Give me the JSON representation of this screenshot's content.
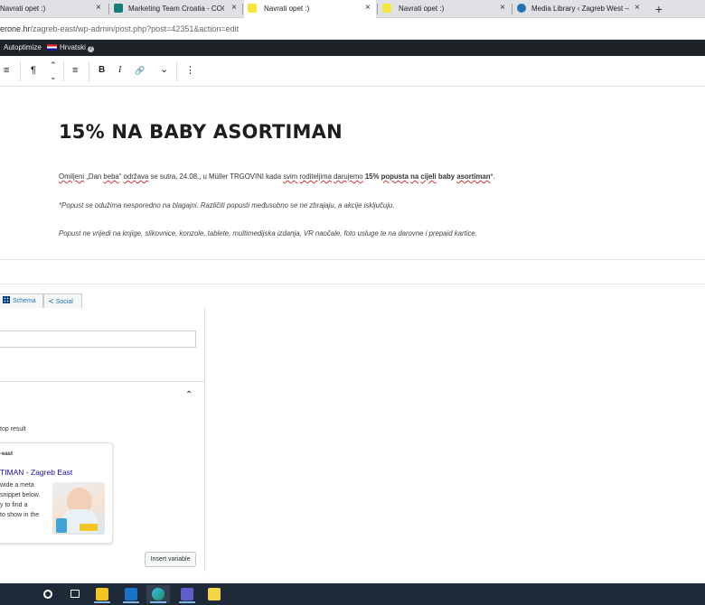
{
  "browser": {
    "tabs": [
      {
        "title": "Navrati opet :)",
        "active": false
      },
      {
        "title": "Marketing Team Croatia - COOL",
        "active": false
      },
      {
        "title": "Navrati opet :)",
        "active": true
      },
      {
        "title": "Navrati opet :)",
        "active": false
      },
      {
        "title": "Media Library ‹ Zagreb West — W",
        "active": false
      }
    ],
    "close_glyph": "×",
    "new_tab_glyph": "+",
    "url_domain": "erone.hr",
    "url_path": "/zagreb-east/wp-admin/post.php?post=42351&action=edit"
  },
  "admin_bar": {
    "autoptimize": "Autoptimize",
    "language": "Hrvatski"
  },
  "toolbar": {
    "list_glyph": "≡",
    "paragraph_glyph": "¶",
    "up_glyph": "⌃",
    "down_glyph": "⌄",
    "align_glyph": "≡",
    "bold": "B",
    "italic": "I",
    "link_glyph": "🔗",
    "more_glyph": "⌄",
    "options_glyph": "⋮"
  },
  "post": {
    "title": "15% NA BABY ASORTIMAN",
    "para1": {
      "w1": "Omiljeni",
      "t1": " „Dan ",
      "w2": "beba",
      "t2": "“ ",
      "w3": "održava",
      "t3": " se sutra, 24.08., u Müller TRGOVINI kada ",
      "w4": "svim",
      "t4": " ",
      "w5": "roditeljima",
      "t5": " ",
      "w6": "darujemo",
      "t6": " ",
      "b1": "15% ",
      "w7": "popusta",
      "t7": " ",
      "w8": "na",
      "t8": " ",
      "w9": "cijeli",
      "b2": " baby ",
      "w10": "asortiman",
      "t9": "*."
    },
    "para2": "*Popust se odužima nesporedno na blagajni. Različiti popusti međusobno se ne zbrajaju, a akcije isključuju.",
    "para3": "Popust ne vrijedi na knjige, slikovnice, konzole, tablete, multimedijska izdanja, VR naočale, foto usluge te na darovne i prepaid kartice."
  },
  "seo_panel": {
    "tab_schema": "Schema",
    "tab_social": "Social",
    "preview_note": "top result",
    "preview_site": "-east",
    "preview_title": "TIMAN - Zagreb East",
    "preview_desc": [
      "wide a meta",
      "snippet below.",
      "y to find a",
      "to show in the"
    ],
    "insert_variable": "Insert variable"
  },
  "taskbar": {
    "items": [
      "cortana-icon",
      "task-view-icon",
      "file-explorer-icon",
      "outlook-icon",
      "edge-icon",
      "teams-icon",
      "sticky-notes-icon"
    ]
  },
  "colors": {
    "admin_bar": "#1d2327",
    "link_blue": "#2271b1",
    "taskbar": "#1f2a38"
  }
}
